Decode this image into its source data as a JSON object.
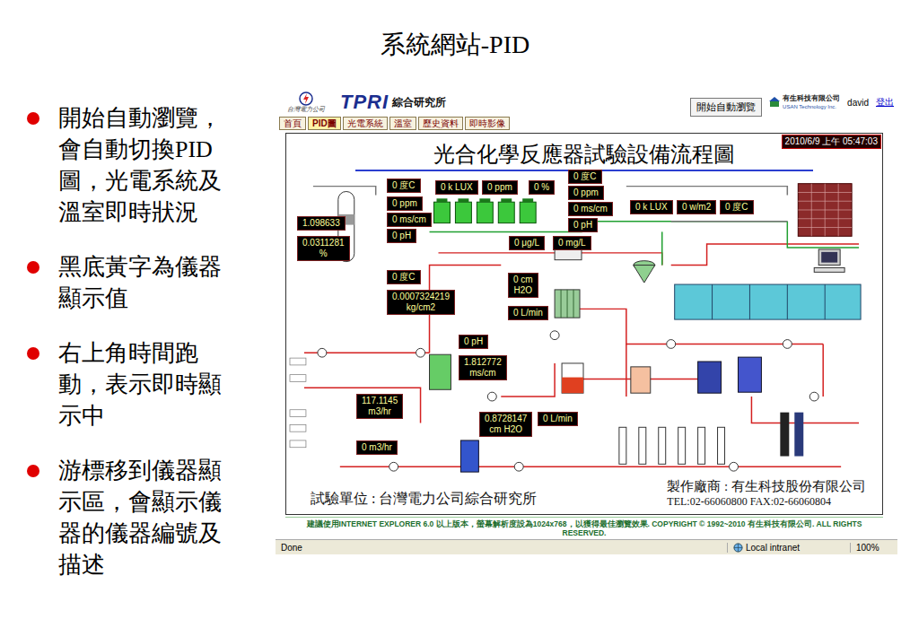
{
  "slide": {
    "title": "系統網站-PID",
    "bullets": [
      "開始自動瀏覽，會自動切換PID圖，光電系統及溫室即時狀況",
      "黑底黃字為儀器顯示值",
      "右上角時間跑動，表示即時顯示中",
      "游標移到儀器顯示區，會顯示儀器的儀器編號及描述"
    ]
  },
  "browser": {
    "header": {
      "logo_caption": "台灣電力公司",
      "brand": "TPRI",
      "brand_sub": "綜合研究所",
      "auto_browse_button": "開始自動瀏覽",
      "company": "有生科技有限公司",
      "company_en": "USAN Technology Inc.",
      "user": "david",
      "logout": "登出"
    },
    "nav": [
      {
        "label": "首頁",
        "selected": false
      },
      {
        "label": "PID圖",
        "selected": true
      },
      {
        "label": "光電系統",
        "selected": false
      },
      {
        "label": "溫室",
        "selected": false
      },
      {
        "label": "歷史資料",
        "selected": false
      },
      {
        "label": "即時影像",
        "selected": false
      }
    ],
    "diagram": {
      "title": "光合化學反應器試驗設備流程圖",
      "timestamp": "2010/6/9 上午 05:47:03",
      "readouts": [
        {
          "lines": [
            "0 度C"
          ]
        },
        {
          "lines": [
            "0 k LUX"
          ]
        },
        {
          "lines": [
            "0 ppm"
          ]
        },
        {
          "lines": [
            "0 %"
          ]
        },
        {
          "lines": [
            "0 度C"
          ]
        },
        {
          "lines": [
            "0 ppm"
          ]
        },
        {
          "lines": [
            "0 ms/cm"
          ]
        },
        {
          "lines": [
            "0 pH"
          ]
        },
        {
          "lines": [
            "1.098633"
          ]
        },
        {
          "lines": [
            "0.0311281",
            "%"
          ]
        },
        {
          "lines": [
            "0 ppm"
          ]
        },
        {
          "lines": [
            "0 ms/cm"
          ]
        },
        {
          "lines": [
            "0 pH"
          ]
        },
        {
          "lines": [
            "0 k LUX"
          ]
        },
        {
          "lines": [
            "0 w/m2"
          ]
        },
        {
          "lines": [
            "0 度C"
          ]
        },
        {
          "lines": [
            "0 μg/L"
          ]
        },
        {
          "lines": [
            "0 mg/L"
          ]
        },
        {
          "lines": [
            "0 度C"
          ]
        },
        {
          "lines": [
            "0.0007324219",
            "kg/cm2"
          ]
        },
        {
          "lines": [
            "0 cm",
            "H2O"
          ]
        },
        {
          "lines": [
            "0 L/min"
          ]
        },
        {
          "lines": [
            "0 pH"
          ]
        },
        {
          "lines": [
            "1.812772",
            "ms/cm"
          ]
        },
        {
          "lines": [
            "117.1145",
            "m3/hr"
          ]
        },
        {
          "lines": [
            "0 m3/hr"
          ]
        },
        {
          "lines": [
            "0.8728147",
            "cm H2O"
          ]
        },
        {
          "lines": [
            "0 L/min"
          ]
        }
      ],
      "footer_left": "試驗單位 : 台灣電力公司綜合研究所",
      "footer_right": "製作廠商 : 有生科技股份有限公司",
      "footer_contact": "TEL:02-66060800   FAX:02-66060804"
    },
    "footer": "建議使用INTERNET EXPLORER 6.0 以上版本，螢幕解析度設為1024x768，以獲得最佳瀏覽效果. COPYRIGHT © 1992~2010 有生科技有限公司. ALL RIGHTS RESERVED.",
    "status_bar": {
      "status": "Done",
      "zone": "Local intranet",
      "zoom": "100%"
    }
  }
}
